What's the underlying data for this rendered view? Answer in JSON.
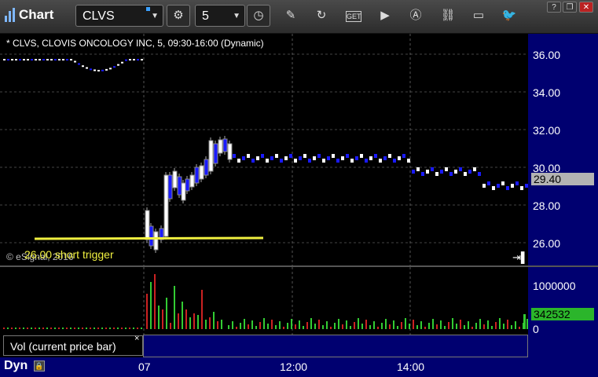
{
  "window": {
    "app_title": "Chart",
    "symbol": "CLVS",
    "interval": "5",
    "controls": {
      "minimize": "?",
      "restore": "❐",
      "close": "✕"
    }
  },
  "toolbar_icons": [
    "settings-gear-icon",
    "clock-icon",
    "pencil-icon",
    "refresh-icon",
    "get-icon",
    "play-icon",
    "alert-a-icon",
    "link-icon",
    "chat-icon",
    "twitter-bird-icon"
  ],
  "price_pane": {
    "label": "* CLVS, CLOVIS ONCOLOGY INC, 5, 09:30-16:00 (Dynamic)",
    "copyright": "© eSignal, 2016",
    "annotation": "26.00 short trigger",
    "last_price": "29.40",
    "axis_ticks": [
      "36.00",
      "34.00",
      "32.00",
      "30.00",
      "28.00",
      "26.00"
    ]
  },
  "volume_pane": {
    "caption": "Vol (current price bar)",
    "close_glyph": "×",
    "last_volume": "342532",
    "axis_ticks": [
      "1000000",
      "0"
    ]
  },
  "time_axis": {
    "mode": "Dyn",
    "ticks": [
      "07",
      "12:00",
      "14:00"
    ]
  },
  "colors": {
    "up": "#ffffff",
    "down": "#1a1aff",
    "axis_bg": "#000070",
    "trigger_line": "#f0f040",
    "vol_up": "#33cc33",
    "vol_down": "#cc2222"
  }
}
